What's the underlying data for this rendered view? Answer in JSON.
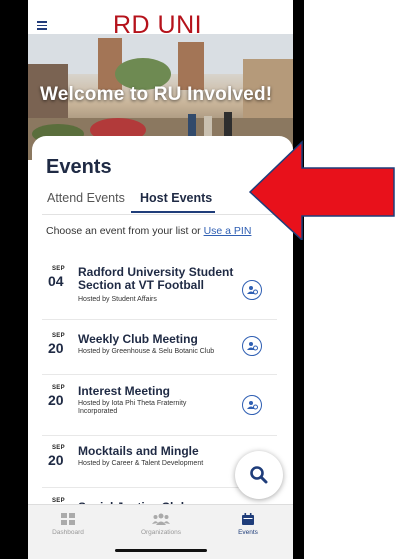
{
  "header": {
    "logo_text": "RD UNI",
    "menu_icon": "hamburger-icon"
  },
  "hero": {
    "welcome": "Welcome to RU Involved!"
  },
  "events": {
    "title": "Events",
    "tabs": [
      {
        "label": "Attend Events",
        "active": false
      },
      {
        "label": "Host Events",
        "active": true
      }
    ],
    "prompt": "Choose an event from your list or ",
    "prompt_link": "Use a PIN",
    "items": [
      {
        "month": "SEP",
        "day": "04",
        "title": "Radford University Student Section at VT Football",
        "host": "Hosted by Student Affairs",
        "action_icon": "user-settings-icon"
      },
      {
        "month": "SEP",
        "day": "20",
        "title": "Weekly Club Meeting",
        "host": "Hosted by Greenhouse & Selu Botanic Club",
        "action_icon": "user-settings-icon"
      },
      {
        "month": "SEP",
        "day": "20",
        "title": "Interest Meeting",
        "host": "Hosted by Iota Phi Theta Fraternity Incorporated",
        "action_icon": "user-settings-icon"
      },
      {
        "month": "SEP",
        "day": "20",
        "title": "Mocktails and Mingle",
        "host": "Hosted by Career & Talent Development"
      },
      {
        "month": "SEP",
        "day": "",
        "title": "Social Justice Club",
        "host": ""
      }
    ]
  },
  "fab": {
    "icon": "search-icon"
  },
  "tabbar": [
    {
      "label": "Dashboard",
      "icon": "grid-icon",
      "active": false
    },
    {
      "label": "Organizations",
      "icon": "people-icon",
      "active": false
    },
    {
      "label": "Events",
      "icon": "calendar-icon",
      "active": true
    }
  ],
  "colors": {
    "primary": "#1f3d7a",
    "brand_red": "#b5121b",
    "arrow_red": "#e8111b",
    "link": "#2f5fb3"
  }
}
